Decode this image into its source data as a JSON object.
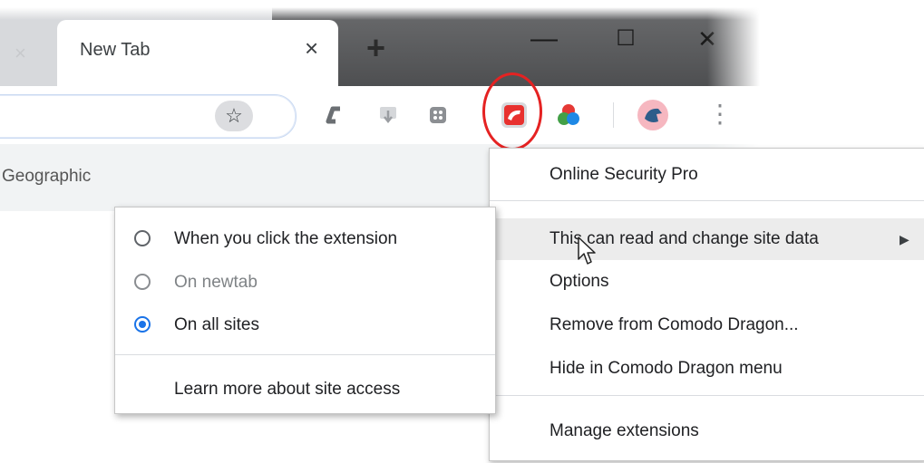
{
  "browser": {
    "tab_title": "New Tab",
    "tab_close_glyph": "×",
    "prev_tab_close_glyph": "×",
    "new_tab_glyph": "+",
    "window_controls": {
      "minimize": "—",
      "maximize": "☐",
      "close": "✕"
    },
    "bookmark_star_glyph": "☆",
    "bookmarks_bar_text": "Geographic",
    "overflow_menu_glyph": "⋮"
  },
  "extensions": [
    {
      "icon": "comodo-c-icon",
      "color": "#6b6f73"
    },
    {
      "icon": "download-manager-icon",
      "color": "#b9bcc0"
    },
    {
      "icon": "media-grabber-icon",
      "color": "#8c8f93"
    },
    {
      "icon": "online-security-pro-icon",
      "color": "#e8312f"
    },
    {
      "icon": "color-circles-icon",
      "colors": [
        "#e53935",
        "#43a047",
        "#1e88e5"
      ]
    },
    {
      "icon": "dragon-profile-avatar",
      "color": "#f6b7c0"
    }
  ],
  "context_menu": {
    "title": "Online Security Pro",
    "items": [
      {
        "label": "This can read and change site data",
        "has_submenu": true,
        "submenu_arrow": "▶",
        "highlighted": true
      },
      {
        "label": "Options"
      },
      {
        "label": "Remove from Comodo Dragon..."
      },
      {
        "label": "Hide in Comodo Dragon menu"
      }
    ],
    "manage": "Manage extensions"
  },
  "submenu": {
    "options": [
      {
        "label": "When you click the extension",
        "checked": false,
        "disabled": false
      },
      {
        "label": "On newtab",
        "checked": false,
        "disabled": true
      },
      {
        "label": "On all sites",
        "checked": true,
        "disabled": false
      }
    ],
    "learn_more": "Learn more about site access"
  },
  "colors": {
    "accent": "#1a73e8",
    "highlight_circle": "#e52222",
    "menu_highlight": "#ececec"
  }
}
